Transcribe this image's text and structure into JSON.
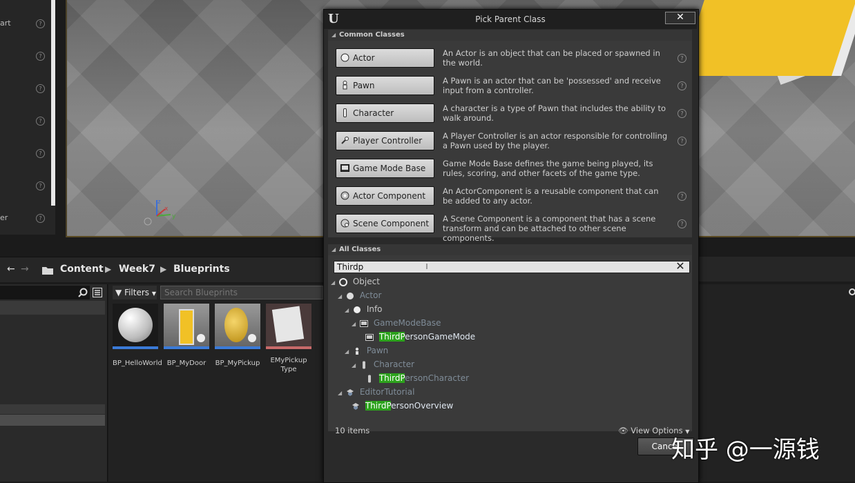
{
  "left_panel": {
    "labels": [
      {
        "text": "art"
      },
      {
        "text": "er"
      }
    ]
  },
  "breadcrumb": {
    "items": [
      "Content",
      "Week7",
      "Blueprints"
    ]
  },
  "content_browser": {
    "filters_label": "Filters",
    "search_placeholder": "Search Blueprints",
    "assets": [
      {
        "name": "BP_HelloWorld"
      },
      {
        "name": "BP_MyDoor"
      },
      {
        "name": "BP_MyPickup"
      },
      {
        "name": "EMyPickup\nType"
      }
    ]
  },
  "dialog": {
    "title": "Pick Parent Class",
    "close_label": "✕",
    "common_header": "Common Classes",
    "common_classes": [
      {
        "label": "Actor",
        "icon": "actor-icon",
        "desc": "An Actor is an object that can be placed or spawned in the world."
      },
      {
        "label": "Pawn",
        "icon": "pawn-icon",
        "desc": "A Pawn is an actor that can be 'possessed' and receive input from a controller."
      },
      {
        "label": "Character",
        "icon": "character-icon",
        "desc": "A character is a type of Pawn that includes the ability to walk around."
      },
      {
        "label": "Player Controller",
        "icon": "player-controller-icon",
        "desc": "A Player Controller is an actor responsible for controlling a Pawn used by the player."
      },
      {
        "label": "Game Mode Base",
        "icon": "game-mode-icon",
        "desc": "Game Mode Base defines the game being played, its rules, scoring, and other facets of the game type."
      },
      {
        "label": "Actor Component",
        "icon": "actor-component-icon",
        "desc": "An ActorComponent is a reusable component that can be added to any actor."
      },
      {
        "label": "Scene Component",
        "icon": "scene-component-icon",
        "desc": "A Scene Component is a component that has a scene transform and can be attached to other scene components."
      }
    ],
    "all_header": "All Classes",
    "search_value": "Thirdp",
    "tree": [
      {
        "label": "Object",
        "hl": "",
        "rest": "Object"
      },
      {
        "label": "Actor",
        "hl": "",
        "rest": "Actor"
      },
      {
        "label": "Info",
        "hl": "",
        "rest": "Info"
      },
      {
        "label": "GameModeBase",
        "hl": "",
        "rest": "GameModeBase"
      },
      {
        "label": "ThirdPersonGameMode",
        "hl": "ThirdP",
        "rest": "ersonGameMode"
      },
      {
        "label": "Pawn",
        "hl": "",
        "rest": "Pawn"
      },
      {
        "label": "Character",
        "hl": "",
        "rest": "Character"
      },
      {
        "label": "ThirdPersonCharacter",
        "hl": "ThirdP",
        "rest": "ersonCharacter"
      },
      {
        "label": "EditorTutorial",
        "hl": "",
        "rest": "EditorTutorial"
      },
      {
        "label": "ThirdPersonOverview",
        "hl": "ThirdP",
        "rest": "ersonOverview"
      }
    ],
    "items_count": "10 items",
    "view_options": "View Options",
    "cancel_label": "Cancel"
  },
  "watermark": "知乎 @一源钱",
  "colors": {
    "highlight": "#2ca21c",
    "asset_bar": "#3b7bd8",
    "door": "#f1c126"
  }
}
